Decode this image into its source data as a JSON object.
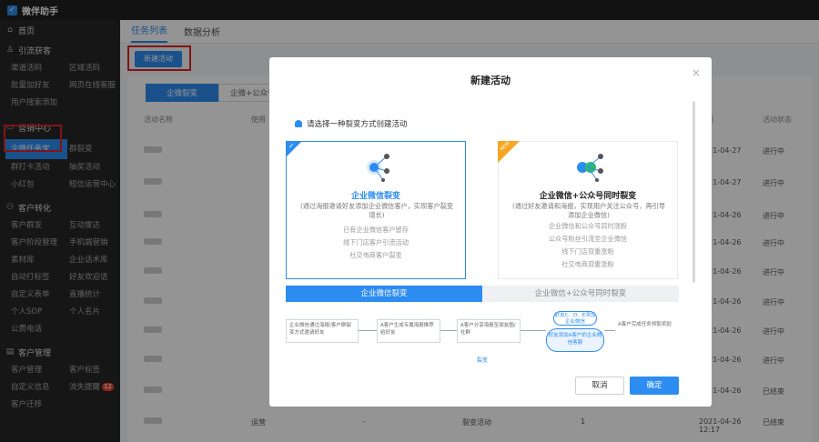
{
  "app": {
    "title": "微伴助手",
    "logo_glyph": "✓"
  },
  "sidebar": {
    "home": {
      "icon": "home-icon",
      "label": "首页"
    },
    "groups": [
      {
        "icon": "user-icon",
        "title": "引流获客",
        "items": [
          "渠道活码",
          "区域活码",
          "批量加好友",
          "网页在线客服",
          "用户搜索添加"
        ]
      },
      {
        "icon": "monitor-icon",
        "title": "营销中心",
        "items": [
          "企微任务宝",
          "群裂变",
          "群打卡活动",
          "抽奖活动",
          "小红包",
          "短信运营中心"
        ]
      },
      {
        "icon": "people-icon",
        "title": "客户转化",
        "items": [
          "客户群发",
          "互动雷达",
          "客户阶段管理",
          "手机端营销",
          "素材库",
          "企业话术库",
          "自动打标签",
          "好友欢迎语",
          "自定义表单",
          "直播统计",
          "个人SOP",
          "个人名片",
          "公费电话"
        ]
      },
      {
        "icon": "folder-icon",
        "title": "客户管理",
        "items": [
          "客户管理",
          "客户标签",
          "自定义信息",
          "流失提醒",
          "客户迁移"
        ]
      }
    ],
    "badge_count": "12"
  },
  "main": {
    "tabs": [
      "任务列表",
      "数据分析"
    ],
    "new_button": "新建活动",
    "subtabs": [
      "企微裂变",
      "企微+公众号"
    ],
    "columns": [
      "活动名称",
      "使用",
      "时间",
      "活动状态"
    ],
    "rows": [
      {
        "date": "2021-04-27",
        "status": "进行中"
      },
      {
        "date": "2021-04-27",
        "status": "进行中"
      },
      {
        "date": "2021-04-26",
        "status": "进行中"
      },
      {
        "date": "2021-04-26",
        "status": "进行中"
      },
      {
        "date": "2021-04-26",
        "status": "进行中"
      },
      {
        "date": "2021-04-26",
        "status": "进行中"
      },
      {
        "date": "2021-04-26",
        "status": "进行中"
      },
      {
        "date": "2021-04-26",
        "status": "进行中"
      },
      {
        "date": "2021-04-26",
        "status": "已结束"
      },
      {
        "date": "2021-04-26",
        "status": "已结束"
      }
    ],
    "last_row": {
      "creator": "运营",
      "dash": "-",
      "type": "裂变活动",
      "count": "1",
      "time": "12:17"
    }
  },
  "modal": {
    "title": "新建活动",
    "close_glyph": "×",
    "hint": "请选择一种裂变方式创建活动",
    "cards": [
      {
        "title": "企业微信裂变",
        "desc": "(通过海报邀请好友添加企业微信客户，实现客户裂变增长)",
        "features": [
          "已有企业微信客户留存",
          "线下门店客户引流活动",
          "社交电商客户裂变"
        ],
        "selected": true
      },
      {
        "title": "企业微信+公众号同时裂变",
        "desc": "(通过好友邀请和海报，实现用户关注公众号，再引导添加企业微信)",
        "features": [
          "企业微信和公众号同时涨粉",
          "公众号粉丝引流至企业微信",
          "线下门店双重涨粉",
          "社交电商双重涨粉"
        ],
        "badge": "NEW",
        "selected": false
      }
    ],
    "flow_tabs": [
      "企业微信裂变",
      "企业微信+公众号同时裂变"
    ],
    "flow": {
      "step1": "企业微信通过海报/客户群裂变方式邀请好友",
      "step2": "A客户生成专属海报推荐给好友",
      "step3": "A客户分享海报至朋友圈/社群",
      "node_top": "好友C、D、E添加企业微信",
      "node_main": "好友添加A客户的企业微信客服",
      "step5": "A客户完成任务领取奖励",
      "label": "裂变"
    },
    "buttons": {
      "cancel": "取消",
      "ok": "确定"
    }
  },
  "colors": {
    "primary": "#2d8cf0",
    "sidebar_bg": "#262626",
    "highlight_red": "#e02424",
    "badge_orange": "#f5a623"
  }
}
